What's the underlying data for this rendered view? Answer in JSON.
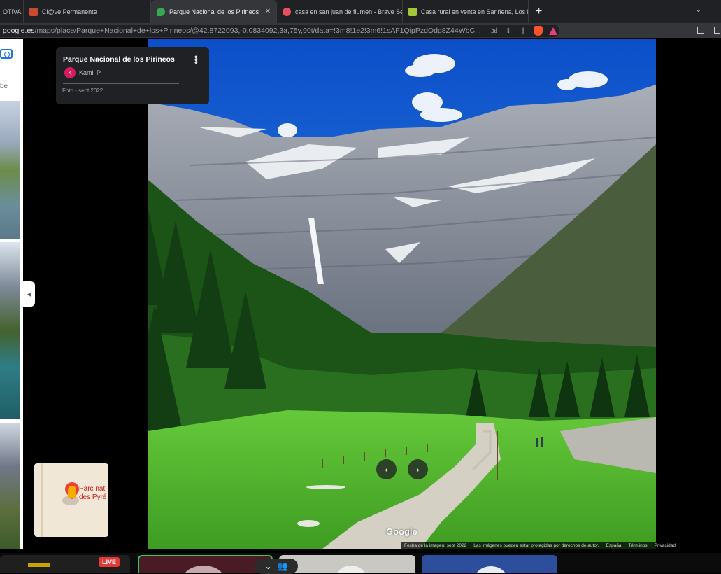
{
  "browser": {
    "tabs": [
      {
        "label": "OTIVA",
        "fav_color": "#202124"
      },
      {
        "label": "Cl@ve Permanente",
        "fav_color": "#c84b31"
      },
      {
        "label": "Parque Nacional de los Pirineos -",
        "fav_color": "#34a853",
        "active": true
      },
      {
        "label": "casa en san juan de flumen - Brave Se",
        "fav_color": "#e8505b"
      },
      {
        "label": "Casa rural en venta en Sariñena, Los M",
        "fav_color": "#a6c63a"
      }
    ],
    "close_glyph": "✕",
    "new_tab_glyph": "+",
    "dropdown_glyph": "⌄",
    "url_domain": "google.es",
    "url_path": "/maps/place/Parque+Nacional+de+los+Pirineos/@42.8722093,-0.0834092,3a,75y,90t/data=!3m8!1e2!3m6!1sAF1QipPzdQdg8Z44WbC..."
  },
  "left_panel": {
    "subscribe_text": "be"
  },
  "info_card": {
    "title": "Parque Nacional de los Pirineos",
    "author_initial": "K",
    "author": "Kamil P",
    "photo_date": "Foto - sept 2022",
    "more_glyph": "•••"
  },
  "photo": {
    "prev_glyph": "‹",
    "next_glyph": "›",
    "watermark": "Google"
  },
  "credits": {
    "image_date": "Fecha de la imagen: sept 2022",
    "copyright": "Las imágenes pueden estar protegidas por derechos de autor.",
    "country": "España",
    "terms": "Términos",
    "privacy": "Privacidad"
  },
  "minimap": {
    "label_line1": "Parc nat",
    "label_line2": "des Pyré"
  },
  "bottom_strip": {
    "live_label": "LIVE",
    "call_close_glyph": "⌄",
    "call_people_glyph": "👥"
  },
  "colors": {
    "sky": "#1f78e0",
    "grass": "#4fb62c",
    "forest": "#1c5418",
    "rock": "#8b8f98",
    "snow": "#f2f4f6"
  }
}
